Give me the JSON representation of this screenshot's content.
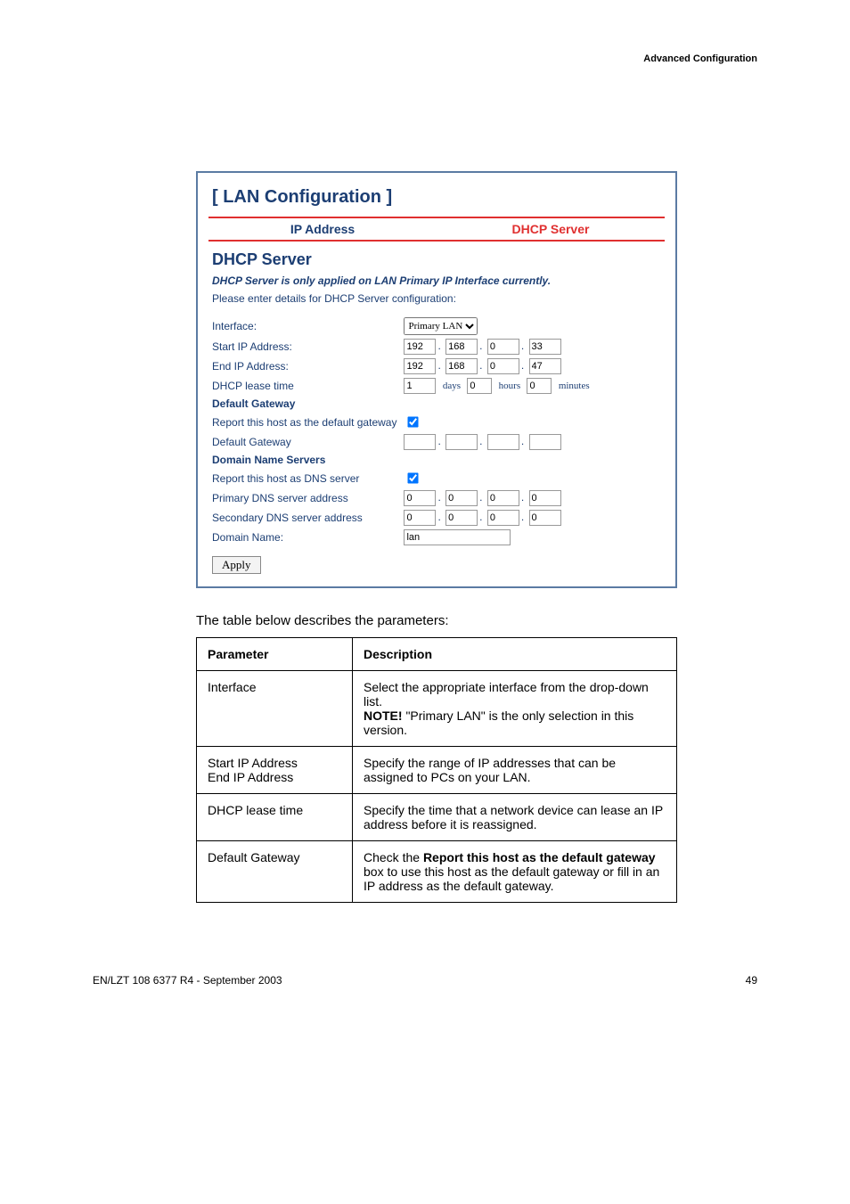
{
  "header": {
    "section": "Advanced Configuration"
  },
  "panel": {
    "title": "[ LAN Configuration ]",
    "tabs": {
      "ip": "IP Address",
      "dhcp": "DHCP Server"
    },
    "section_title": "DHCP Server",
    "note": "DHCP Server is only applied on LAN Primary IP Interface currently.",
    "hint": "Please enter details for DHCP Server configuration:"
  },
  "form": {
    "interface_label": "Interface:",
    "interface_value": "Primary LAN",
    "start_label": "Start IP Address:",
    "start_ip": [
      "192",
      "168",
      "0",
      "33"
    ],
    "end_label": "End IP Address:",
    "end_ip": [
      "192",
      "168",
      "0",
      "47"
    ],
    "lease_label": "DHCP lease time",
    "lease_days": "1",
    "lease_hours": "0",
    "lease_minutes": "0",
    "unit_days": "days",
    "unit_hours": "hours",
    "unit_minutes": "minutes",
    "gw_heading": "Default Gateway",
    "gw_report_label": "Report this host as the default gateway",
    "gw_default_label": "Default Gateway",
    "gw_ip": [
      "",
      "",
      "",
      ""
    ],
    "dns_heading": "Domain Name Servers",
    "dns_report_label": "Report this host as DNS server",
    "dns_primary_label": "Primary DNS server address",
    "dns_primary": [
      "0",
      "0",
      "0",
      "0"
    ],
    "dns_secondary_label": "Secondary DNS server address",
    "dns_secondary": [
      "0",
      "0",
      "0",
      "0"
    ],
    "domain_label": "Domain Name:",
    "domain_value": "lan",
    "apply": "Apply"
  },
  "caption": "The table below describes the parameters:",
  "table": {
    "h1": "Parameter",
    "h2": "Description",
    "rows": [
      {
        "p": "Interface",
        "d_pre": "Select the appropriate interface from the drop-down list.",
        "d_note_b": "NOTE!",
        "d_note_rest": " \"Primary LAN\" is the only selection in this version."
      },
      {
        "p": "Start IP Address\nEnd IP Address",
        "d": "Specify the range of IP addresses that can be assigned to PCs on your LAN."
      },
      {
        "p": "DHCP lease time",
        "d": "Specify the time that a network device can lease an IP address before it is reassigned."
      },
      {
        "p": "Default Gateway",
        "d_pre": "Check the ",
        "d_b": "Report this host as the default gateway",
        "d_post": " box to use this host as the default gateway or fill in an IP address as the default gateway."
      }
    ]
  },
  "footer": {
    "left": "EN/LZT 108 6377 R4 - September 2003",
    "right": "49"
  }
}
